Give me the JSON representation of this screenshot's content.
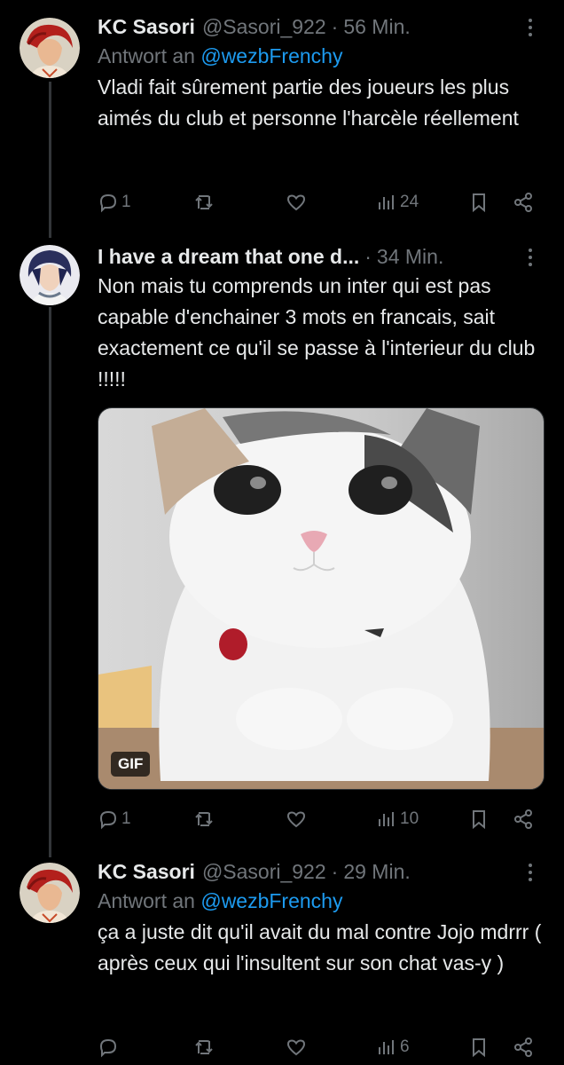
{
  "tweets": [
    {
      "name": "KC Sasori",
      "handle": "@Sasori_922",
      "time": "56 Min.",
      "replying_prefix": "Antwort an",
      "replying_to": "@wezbFrenchy",
      "text": "Vladi fait sûrement partie des joueurs les plus aimés du club et personne l'harcèle réellement",
      "replies": "1",
      "views": "24"
    },
    {
      "name": "I have a dream that one d...",
      "time": "34 Min.",
      "text": "Non mais tu comprends un inter qui est pas capable d'enchainer 3 mots en francais, sait exactement ce qu'il se passe à l'interieur du club !!!!!",
      "media_badge": "GIF",
      "replies": "1",
      "views": "10"
    },
    {
      "name": "KC Sasori",
      "handle": "@Sasori_922",
      "time": "29 Min.",
      "replying_prefix": "Antwort an",
      "replying_to": "@wezbFrenchy",
      "text": "ça a juste dit qu'il avait du mal contre Jojo mdrrr ( après ceux qui l'insultent sur son chat vas-y )",
      "views": "6"
    }
  ],
  "icons": {
    "reply": "reply-icon",
    "retweet": "retweet-icon",
    "like": "like-icon",
    "views": "views-icon",
    "bookmark": "bookmark-icon",
    "share": "share-icon",
    "more": "more-icon"
  },
  "colors": {
    "background": "#000000",
    "text": "#e7e9ea",
    "muted": "#71767b",
    "link": "#1d9bf0"
  }
}
